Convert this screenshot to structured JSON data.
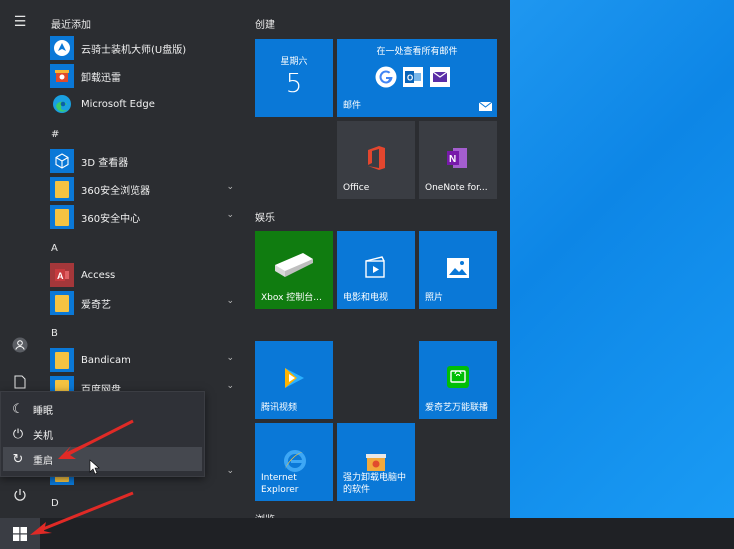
{
  "applist": {
    "section_recent": "最近添加",
    "recent": [
      {
        "label": "云骑士装机大师(U盘版)",
        "icon": "yunqishi-icon"
      },
      {
        "label": "卸载迅雷",
        "icon": "xunlei-uninstall-icon"
      },
      {
        "label": "Microsoft Edge",
        "icon": "edge-icon"
      }
    ],
    "section_hash": "#",
    "hash_apps": [
      {
        "label": "3D 查看器",
        "icon": "3d-viewer-icon"
      },
      {
        "label": "360安全浏览器",
        "icon": "folder-icon"
      },
      {
        "label": "360安全中心",
        "icon": "folder-icon"
      }
    ],
    "section_a": "A",
    "a_apps": [
      {
        "label": "Access",
        "icon": "access-icon"
      },
      {
        "label": "爱奇艺",
        "icon": "folder-icon"
      }
    ],
    "section_b": "B",
    "b_apps": [
      {
        "label": "Bandicam",
        "icon": "folder-icon"
      },
      {
        "label": "百度网盘",
        "icon": "folder-icon"
      }
    ],
    "section_d": "D"
  },
  "power_menu": {
    "items": [
      {
        "label": "睡眠",
        "icon": "moon-icon"
      },
      {
        "label": "关机",
        "icon": "power-icon"
      },
      {
        "label": "重启",
        "icon": "restart-icon"
      }
    ]
  },
  "tiles": {
    "group_create": "创建",
    "group_entertain": "娱乐",
    "group_browse": "浏览",
    "calendar": {
      "weekday": "星期六",
      "day": "5"
    },
    "mail": {
      "header": "在一处查看所有邮件",
      "label": "邮件"
    },
    "office": "Office",
    "onenote": "OneNote for...",
    "xbox": "Xbox 控制台...",
    "movies": "电影和电视",
    "photos": "照片",
    "tencent": "腾讯视频",
    "iqiyi_cast": "爱奇艺万能联播",
    "ie": "Internet Explorer",
    "uninstall": "强力卸载电脑中的软件"
  },
  "colors": {
    "accent": "#0a78d7",
    "xbox": "#107c10",
    "arrow": "#e02a26",
    "startbg": "#2b2d31"
  }
}
